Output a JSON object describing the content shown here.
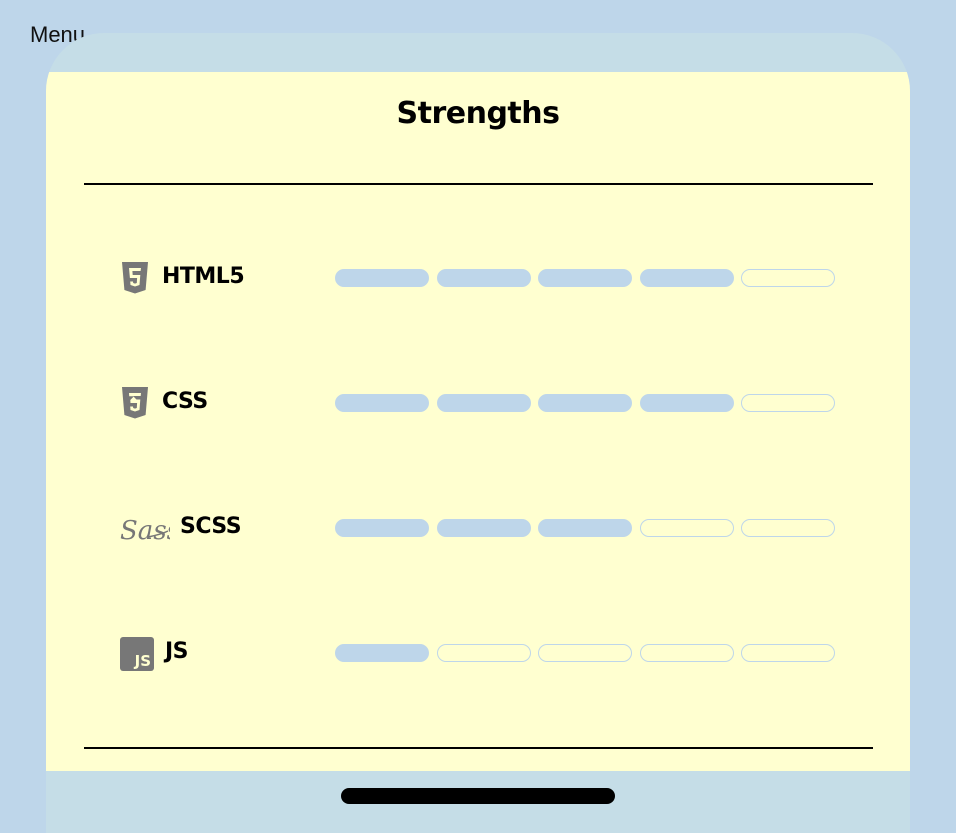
{
  "menu": {
    "label": "Menu"
  },
  "card": {
    "title": "Strengths"
  },
  "colors": {
    "background": "#bed6ea",
    "card": "#ffffd0",
    "bar_fill": "#bed6ea",
    "icon": "#777777"
  },
  "max_level": 5,
  "skills": [
    {
      "name": "HTML5",
      "icon": "html5-icon",
      "level": 4
    },
    {
      "name": "CSS",
      "icon": "css3-icon",
      "level": 4
    },
    {
      "name": "SCSS",
      "icon": "sass-icon",
      "level": 3
    },
    {
      "name": "JS",
      "icon": "javascript-icon",
      "level": 1
    }
  ],
  "icon_text": {
    "js": "JS",
    "sass": "Sass"
  }
}
